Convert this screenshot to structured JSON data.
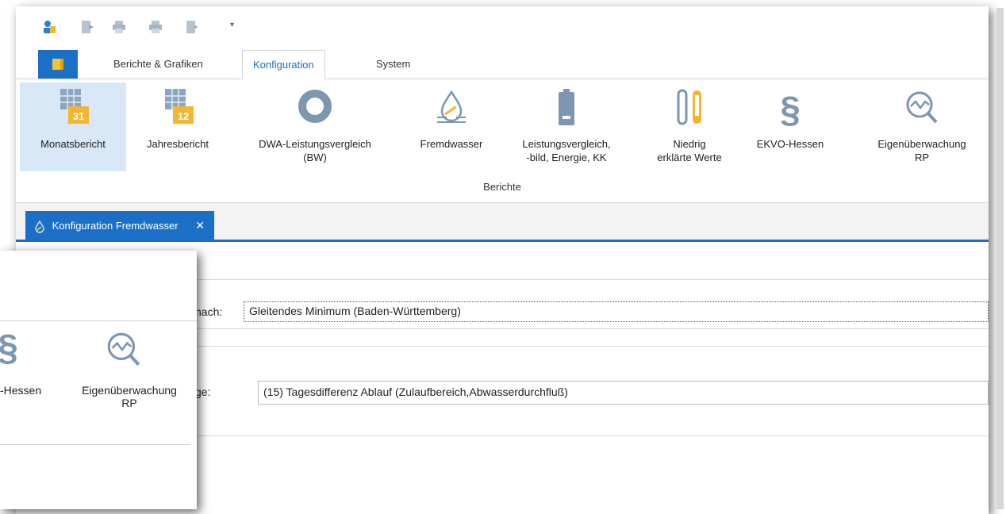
{
  "ribbon_tabs": [
    "Berichte & Grafiken",
    "Konfiguration",
    "System"
  ],
  "active_tab": "Konfiguration",
  "ribbon_buttons": [
    {
      "line1": "Monatsbericht",
      "line2": "",
      "icon": "calendar-31-icon"
    },
    {
      "line1": "Jahresbericht",
      "line2": "",
      "icon": "calendar-12-icon"
    },
    {
      "line1": "DWA-Leistungsvergleich",
      "line2": "(BW)",
      "icon": "ring-icon"
    },
    {
      "line1": "Fremdwasser",
      "line2": "",
      "icon": "water-drop-icon"
    },
    {
      "line1": "Leistungsvergleich,",
      "line2": "-bild, Energie, KK",
      "icon": "battery-icon"
    },
    {
      "line1": "Niedrig",
      "line2": "erklärte Werte",
      "icon": "test-tubes-icon"
    },
    {
      "line1": "EKVO-Hessen",
      "line2": "",
      "icon": "paragraph-icon"
    },
    {
      "line1": "Eigenüberwachung",
      "line2": "RP",
      "icon": "chart-magnifier-icon"
    }
  ],
  "ribbon_group_label": "Berichte",
  "document_tab": {
    "label": "Konfiguration Fremdwasser",
    "close": "✕"
  },
  "content": {
    "row1_label": "nach:",
    "row1_value": "Gleitendes Minimum (Baden-Württemberg)",
    "row2_label": "ge:",
    "row2_value": "(15) Tagesdifferenz Ablauf (Zulaufbereich,Abwasserdurchfluß)"
  },
  "popup": {
    "label_left": "-Hessen",
    "label_right_line1": "Eigenüberwachung",
    "label_right_line2": "RP"
  },
  "colors": {
    "accent": "#1c6fc7",
    "orange": "#f2b632",
    "icon_gray": "#7d96b2"
  }
}
